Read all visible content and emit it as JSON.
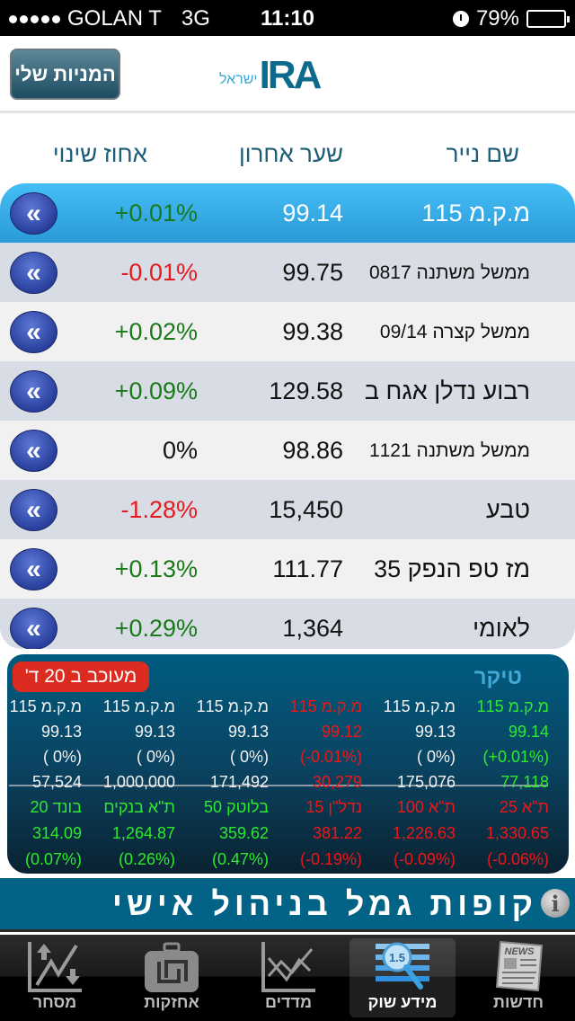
{
  "status_bar": {
    "carrier": "GOLAN T",
    "network": "3G",
    "time": "11:10",
    "battery_percent_text": "79%",
    "battery_level": 0.79
  },
  "header": {
    "my_stocks_button": "המניות שלי",
    "logo_text": "IRA",
    "logo_subtext": "ישראל"
  },
  "columns": {
    "name": "שם נייר",
    "last": "שער אחרון",
    "change": "אחוז שינוי"
  },
  "stocks": [
    {
      "name": "מ.ק.מ 115",
      "last": "99.14",
      "change": "+0.01%",
      "dir": "up",
      "selected": true,
      "small": false
    },
    {
      "name": "ממשל משתנה 0817",
      "last": "99.75",
      "change": "-0.01%",
      "dir": "down",
      "selected": false,
      "small": true
    },
    {
      "name": "ממשל קצרה 09/14",
      "last": "99.38",
      "change": "+0.02%",
      "dir": "up",
      "selected": false,
      "small": true
    },
    {
      "name": "רבוע נדלן אגח ב",
      "last": "129.58",
      "change": "+0.09%",
      "dir": "up",
      "selected": false,
      "small": false
    },
    {
      "name": "ממשל משתנה 1121",
      "last": "98.86",
      "change": "0%",
      "dir": "flat",
      "selected": false,
      "small": true
    },
    {
      "name": "טבע",
      "last": "15,450",
      "change": "-1.28%",
      "dir": "down",
      "selected": false,
      "small": false
    },
    {
      "name": "מז טפ הנפק 35",
      "last": "111.77",
      "change": "+0.13%",
      "dir": "up",
      "selected": false,
      "small": false
    },
    {
      "name": "לאומי",
      "last": "1,364",
      "change": "+0.29%",
      "dir": "up",
      "selected": false,
      "small": false
    }
  ],
  "ticker": {
    "title": "טיקר",
    "delay_badge": "מעוכב ב 20 ד'",
    "trades": [
      {
        "name": "מ.ק.מ 115",
        "price": "99.14",
        "change": "(+0.01%)",
        "volume": "77,118",
        "color": "green"
      },
      {
        "name": "מ.ק.מ 115",
        "price": "99.13",
        "change": "( 0%)",
        "volume": "175,076",
        "color": "white"
      },
      {
        "name": "מ.ק.מ 115",
        "price": "99.12",
        "change": "(-0.01%)",
        "volume": "30,279",
        "color": "red"
      },
      {
        "name": "מ.ק.מ 115",
        "price": "99.13",
        "change": "( 0%)",
        "volume": "171,492",
        "color": "white"
      },
      {
        "name": "מ.ק.מ 115",
        "price": "99.13",
        "change": "( 0%)",
        "volume": "1,000,000",
        "color": "white"
      },
      {
        "name": "מ.ק.מ 115",
        "price": "99.13",
        "change": "( 0%)",
        "volume": "57,524",
        "color": "white"
      }
    ],
    "indices": [
      {
        "name": "ת\"א 25",
        "value": "1,330.65",
        "change": "(-0.06%)",
        "color": "red"
      },
      {
        "name": "ת\"א 100",
        "value": "1,226.63",
        "change": "(-0.09%)",
        "color": "red"
      },
      {
        "name": "נדל\"ן 15",
        "value": "381.22",
        "change": "(-0.19%)",
        "color": "red"
      },
      {
        "name": "בלוטק 50",
        "value": "359.62",
        "change": "(0.47%)",
        "color": "green"
      },
      {
        "name": "ת\"א בנקים",
        "value": "1,264.87",
        "change": "(0.26%)",
        "color": "green"
      },
      {
        "name": "בונד 20",
        "value": "314.09",
        "change": "(0.07%)",
        "color": "green"
      }
    ]
  },
  "banner": {
    "text": "קופות גמל בניהול אישי",
    "icon": "info-icon"
  },
  "tabs": [
    {
      "label": "חדשות",
      "icon": "news-icon",
      "active": false
    },
    {
      "label": "מידע שוק",
      "icon": "market-info-icon",
      "active": true,
      "badge": "1.5"
    },
    {
      "label": "מדדים",
      "icon": "indices-chart-icon",
      "active": false
    },
    {
      "label": "אחזקות",
      "icon": "holdings-briefcase-icon",
      "active": false
    },
    {
      "label": "מסחר",
      "icon": "trading-chart-icon",
      "active": false
    }
  ],
  "colors": {
    "positive": "#1a7a1a",
    "negative": "#e8191d",
    "selected_row": "#2a9bd8",
    "ticker_green": "#2dea2d",
    "ticker_red": "#f01616",
    "brand": "#0c6a8b"
  }
}
